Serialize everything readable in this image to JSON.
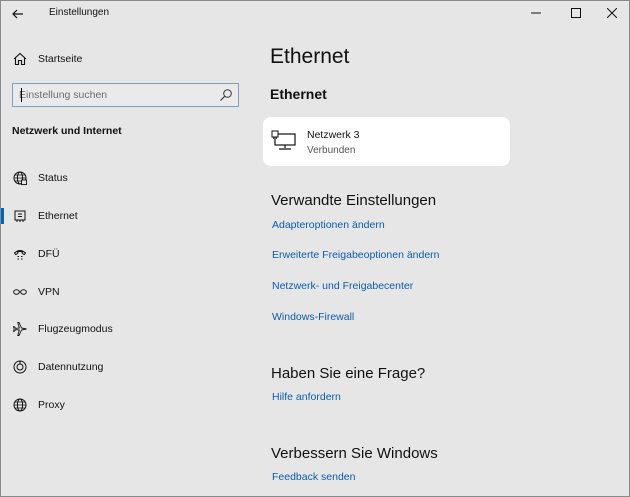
{
  "window": {
    "title": "Einstellungen"
  },
  "titlebar": {
    "back_icon": "arrow-left-icon",
    "minimize_icon": "minimize-icon",
    "maximize_icon": "maximize-icon",
    "close_icon": "close-icon"
  },
  "sidebar": {
    "home_label": "Startseite",
    "search_placeholder": "Einstellung suchen",
    "section_heading": "Netzwerk und Internet",
    "items": [
      {
        "label": "Status",
        "icon": "globe-status-icon"
      },
      {
        "label": "Ethernet",
        "icon": "ethernet-icon",
        "selected": true
      },
      {
        "label": "DFÜ",
        "icon": "dialup-icon"
      },
      {
        "label": "VPN",
        "icon": "vpn-icon"
      },
      {
        "label": "Flugzeugmodus",
        "icon": "airplane-icon"
      },
      {
        "label": "Datennutzung",
        "icon": "data-usage-icon"
      },
      {
        "label": "Proxy",
        "icon": "globe-icon"
      }
    ]
  },
  "main": {
    "page_title": "Ethernet",
    "sub_title": "Ethernet",
    "network": {
      "name": "Netzwerk 3",
      "status": "Verbunden",
      "icon": "network-computer-icon"
    },
    "related": {
      "title": "Verwandte Einstellungen",
      "links": [
        "Adapteroptionen ändern",
        "Erweiterte Freigabeoptionen ändern",
        "Netzwerk- und Freigabecenter",
        "Windows-Firewall"
      ]
    },
    "question": {
      "title": "Haben Sie eine Frage?",
      "link": "Hilfe anfordern"
    },
    "improve": {
      "title": "Verbessern Sie Windows",
      "link": "Feedback senden"
    }
  },
  "colors": {
    "accent": "#0067c0",
    "link": "#0a5cb0",
    "background": "#e6e6e6"
  }
}
